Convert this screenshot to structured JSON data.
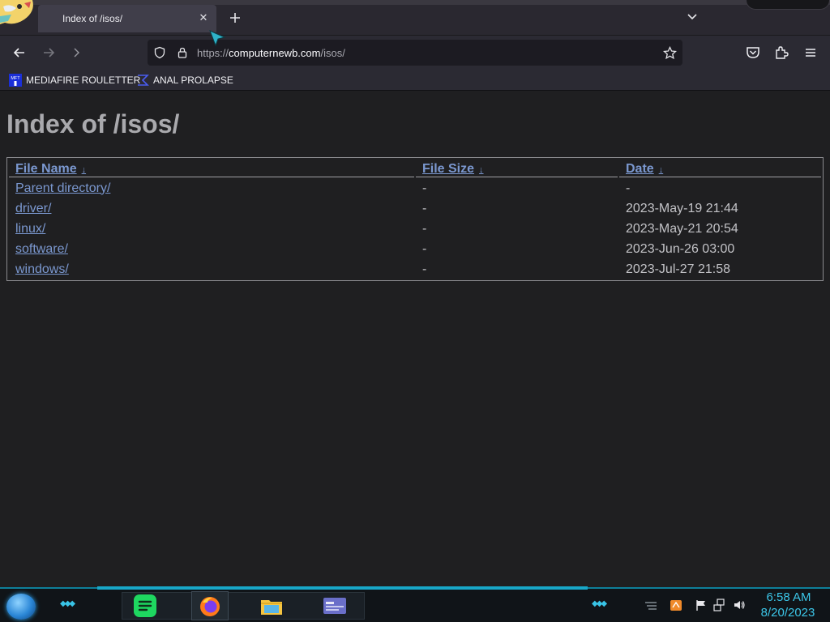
{
  "browser": {
    "tab": {
      "title": "Index of /isos/"
    },
    "url": {
      "scheme": "https://",
      "host": "computernewb.com",
      "path": "/isos/"
    },
    "bookmarks": [
      {
        "label": "MEDIAFIRE ROULETTER",
        "favicon": "mft-favicon"
      },
      {
        "label": "ANAL PROLAPSE",
        "favicon": "sigma-favicon"
      }
    ]
  },
  "page": {
    "title": "Index of /isos/",
    "columns": [
      {
        "label": "File Name",
        "sort": "↓"
      },
      {
        "label": "File Size",
        "sort": "↓"
      },
      {
        "label": "Date",
        "sort": "↓"
      }
    ],
    "rows": [
      {
        "name": "Parent directory/",
        "size": "-",
        "date": "-"
      },
      {
        "name": "driver/",
        "size": "-",
        "date": "2023-May-19 21:44"
      },
      {
        "name": "linux/",
        "size": "-",
        "date": "2023-May-21 20:54"
      },
      {
        "name": "software/",
        "size": "-",
        "date": "2023-Jun-26 03:00"
      },
      {
        "name": "windows/",
        "size": "-",
        "date": "2023-Jul-27 21:58"
      }
    ]
  },
  "taskbar": {
    "apps": [
      "spotify-icon",
      "firefox-icon",
      "file-explorer-icon",
      "app-window-icon"
    ],
    "tray": [
      "network-drive-icon",
      "notification-flag-icon",
      "network-icon",
      "volume-icon"
    ],
    "clock": {
      "time": "6:58 AM",
      "date": "8/20/2023"
    }
  },
  "colors": {
    "link": "#7b98d0",
    "page_bg": "#1f1f21",
    "accent_cyan": "#3cc6e8"
  }
}
